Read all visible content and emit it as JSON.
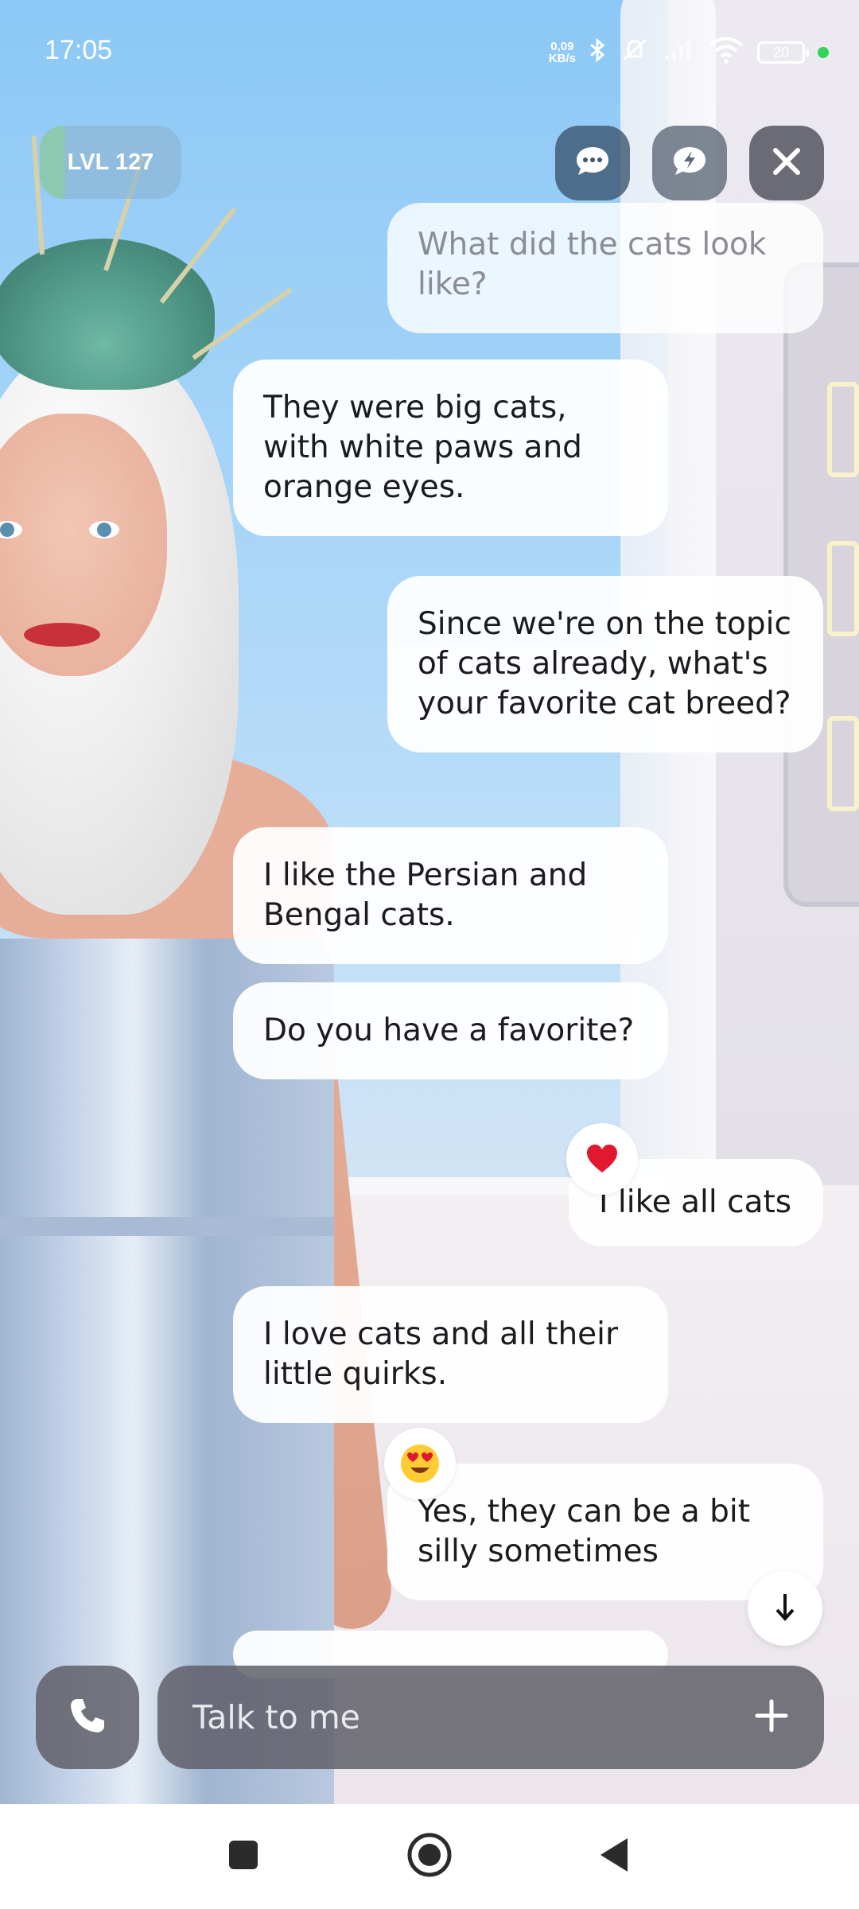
{
  "status_bar": {
    "time": "17:05",
    "net_speed_value": "0,09",
    "net_speed_unit": "KB/s",
    "battery": "20",
    "icons": [
      "bluetooth-icon",
      "silent-icon",
      "signal-icon",
      "wifi-icon",
      "battery-icon",
      "green-dot"
    ]
  },
  "header": {
    "level_label": "LVL 127",
    "level_progress": 0.18,
    "buttons": [
      "chat-bubble-icon",
      "flash-bubble-icon",
      "close-icon"
    ]
  },
  "messages": [
    {
      "sender": "user",
      "text": "What did the cats look like?",
      "faded": true
    },
    {
      "sender": "ai",
      "text": "They were big cats, with white paws and orange eyes."
    },
    {
      "sender": "user",
      "text": "Since we're on the topic of cats already, what's your favorite cat breed?"
    },
    {
      "sender": "ai",
      "text": "I like the Persian and Bengal cats."
    },
    {
      "sender": "ai",
      "text": "Do you have a favorite?"
    },
    {
      "sender": "user",
      "text": "I like all cats",
      "reaction": "❤️"
    },
    {
      "sender": "ai",
      "text": "I love cats and all their little quirks."
    },
    {
      "sender": "user",
      "text": "Yes, they can be a bit silly sometimes",
      "reaction": "😍"
    }
  ],
  "input": {
    "placeholder": "Talk to me"
  },
  "colors": {
    "bubble": "#ffffff",
    "text": "#1b1b1f",
    "control_bg": "#5f5f69",
    "level_progress": "#8ccda0"
  },
  "nav": [
    "recents-square-icon",
    "home-circle-icon",
    "back-triangle-icon"
  ]
}
